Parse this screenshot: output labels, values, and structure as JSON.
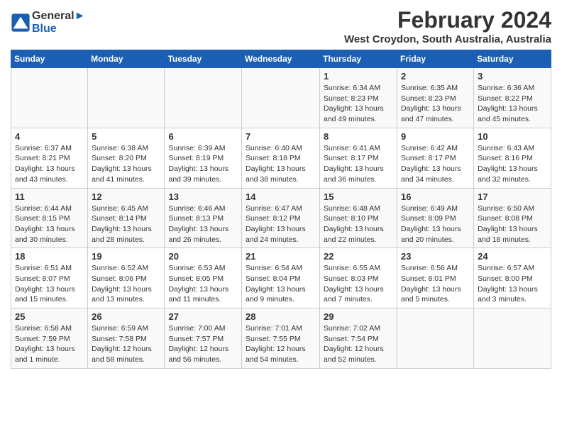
{
  "header": {
    "logo_line1": "General",
    "logo_line2": "Blue",
    "month_year": "February 2024",
    "location": "West Croydon, South Australia, Australia"
  },
  "weekdays": [
    "Sunday",
    "Monday",
    "Tuesday",
    "Wednesday",
    "Thursday",
    "Friday",
    "Saturday"
  ],
  "weeks": [
    [
      {
        "day": "",
        "info": ""
      },
      {
        "day": "",
        "info": ""
      },
      {
        "day": "",
        "info": ""
      },
      {
        "day": "",
        "info": ""
      },
      {
        "day": "1",
        "info": "Sunrise: 6:34 AM\nSunset: 8:23 PM\nDaylight: 13 hours\nand 49 minutes."
      },
      {
        "day": "2",
        "info": "Sunrise: 6:35 AM\nSunset: 8:23 PM\nDaylight: 13 hours\nand 47 minutes."
      },
      {
        "day": "3",
        "info": "Sunrise: 6:36 AM\nSunset: 8:22 PM\nDaylight: 13 hours\nand 45 minutes."
      }
    ],
    [
      {
        "day": "4",
        "info": "Sunrise: 6:37 AM\nSunset: 8:21 PM\nDaylight: 13 hours\nand 43 minutes."
      },
      {
        "day": "5",
        "info": "Sunrise: 6:38 AM\nSunset: 8:20 PM\nDaylight: 13 hours\nand 41 minutes."
      },
      {
        "day": "6",
        "info": "Sunrise: 6:39 AM\nSunset: 8:19 PM\nDaylight: 13 hours\nand 39 minutes."
      },
      {
        "day": "7",
        "info": "Sunrise: 6:40 AM\nSunset: 8:18 PM\nDaylight: 13 hours\nand 38 minutes."
      },
      {
        "day": "8",
        "info": "Sunrise: 6:41 AM\nSunset: 8:17 PM\nDaylight: 13 hours\nand 36 minutes."
      },
      {
        "day": "9",
        "info": "Sunrise: 6:42 AM\nSunset: 8:17 PM\nDaylight: 13 hours\nand 34 minutes."
      },
      {
        "day": "10",
        "info": "Sunrise: 6:43 AM\nSunset: 8:16 PM\nDaylight: 13 hours\nand 32 minutes."
      }
    ],
    [
      {
        "day": "11",
        "info": "Sunrise: 6:44 AM\nSunset: 8:15 PM\nDaylight: 13 hours\nand 30 minutes."
      },
      {
        "day": "12",
        "info": "Sunrise: 6:45 AM\nSunset: 8:14 PM\nDaylight: 13 hours\nand 28 minutes."
      },
      {
        "day": "13",
        "info": "Sunrise: 6:46 AM\nSunset: 8:13 PM\nDaylight: 13 hours\nand 26 minutes."
      },
      {
        "day": "14",
        "info": "Sunrise: 6:47 AM\nSunset: 8:12 PM\nDaylight: 13 hours\nand 24 minutes."
      },
      {
        "day": "15",
        "info": "Sunrise: 6:48 AM\nSunset: 8:10 PM\nDaylight: 13 hours\nand 22 minutes."
      },
      {
        "day": "16",
        "info": "Sunrise: 6:49 AM\nSunset: 8:09 PM\nDaylight: 13 hours\nand 20 minutes."
      },
      {
        "day": "17",
        "info": "Sunrise: 6:50 AM\nSunset: 8:08 PM\nDaylight: 13 hours\nand 18 minutes."
      }
    ],
    [
      {
        "day": "18",
        "info": "Sunrise: 6:51 AM\nSunset: 8:07 PM\nDaylight: 13 hours\nand 15 minutes."
      },
      {
        "day": "19",
        "info": "Sunrise: 6:52 AM\nSunset: 8:06 PM\nDaylight: 13 hours\nand 13 minutes."
      },
      {
        "day": "20",
        "info": "Sunrise: 6:53 AM\nSunset: 8:05 PM\nDaylight: 13 hours\nand 11 minutes."
      },
      {
        "day": "21",
        "info": "Sunrise: 6:54 AM\nSunset: 8:04 PM\nDaylight: 13 hours\nand 9 minutes."
      },
      {
        "day": "22",
        "info": "Sunrise: 6:55 AM\nSunset: 8:03 PM\nDaylight: 13 hours\nand 7 minutes."
      },
      {
        "day": "23",
        "info": "Sunrise: 6:56 AM\nSunset: 8:01 PM\nDaylight: 13 hours\nand 5 minutes."
      },
      {
        "day": "24",
        "info": "Sunrise: 6:57 AM\nSunset: 8:00 PM\nDaylight: 13 hours\nand 3 minutes."
      }
    ],
    [
      {
        "day": "25",
        "info": "Sunrise: 6:58 AM\nSunset: 7:59 PM\nDaylight: 13 hours\nand 1 minute."
      },
      {
        "day": "26",
        "info": "Sunrise: 6:59 AM\nSunset: 7:58 PM\nDaylight: 12 hours\nand 58 minutes."
      },
      {
        "day": "27",
        "info": "Sunrise: 7:00 AM\nSunset: 7:57 PM\nDaylight: 12 hours\nand 56 minutes."
      },
      {
        "day": "28",
        "info": "Sunrise: 7:01 AM\nSunset: 7:55 PM\nDaylight: 12 hours\nand 54 minutes."
      },
      {
        "day": "29",
        "info": "Sunrise: 7:02 AM\nSunset: 7:54 PM\nDaylight: 12 hours\nand 52 minutes."
      },
      {
        "day": "",
        "info": ""
      },
      {
        "day": "",
        "info": ""
      }
    ]
  ]
}
